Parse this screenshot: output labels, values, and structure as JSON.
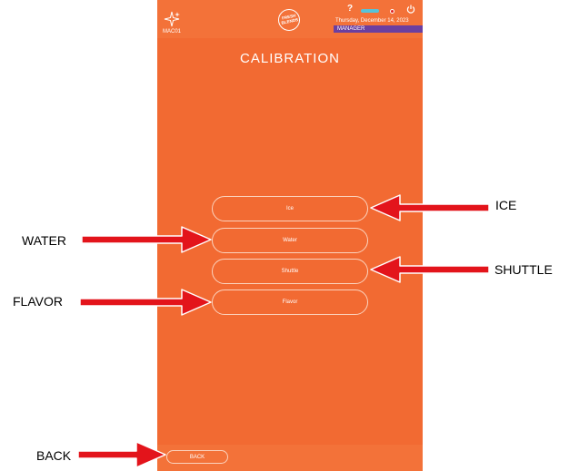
{
  "header": {
    "device_id": "MAC01",
    "logo_text": "FRESH\nBLENDS",
    "help_label": "?",
    "date": "Thursday, December 14, 2023",
    "role": "MANAGER"
  },
  "main": {
    "title": "CALIBRATION",
    "buttons": [
      {
        "label": "Ice"
      },
      {
        "label": "Water"
      },
      {
        "label": "Shuttle"
      },
      {
        "label": "Flavor"
      }
    ]
  },
  "footer": {
    "back_label": "BACK"
  },
  "annotations": {
    "ice": "ICE",
    "water": "WATER",
    "shuttle": "SHUTTLE",
    "flavor": "FLAVOR",
    "back": "BACK"
  },
  "colors": {
    "screen": "#F26A32",
    "bars": "#F37239",
    "role_badge": "#6B3FA0",
    "wifi": "#56C3D9",
    "arrow": "#E3141B"
  }
}
